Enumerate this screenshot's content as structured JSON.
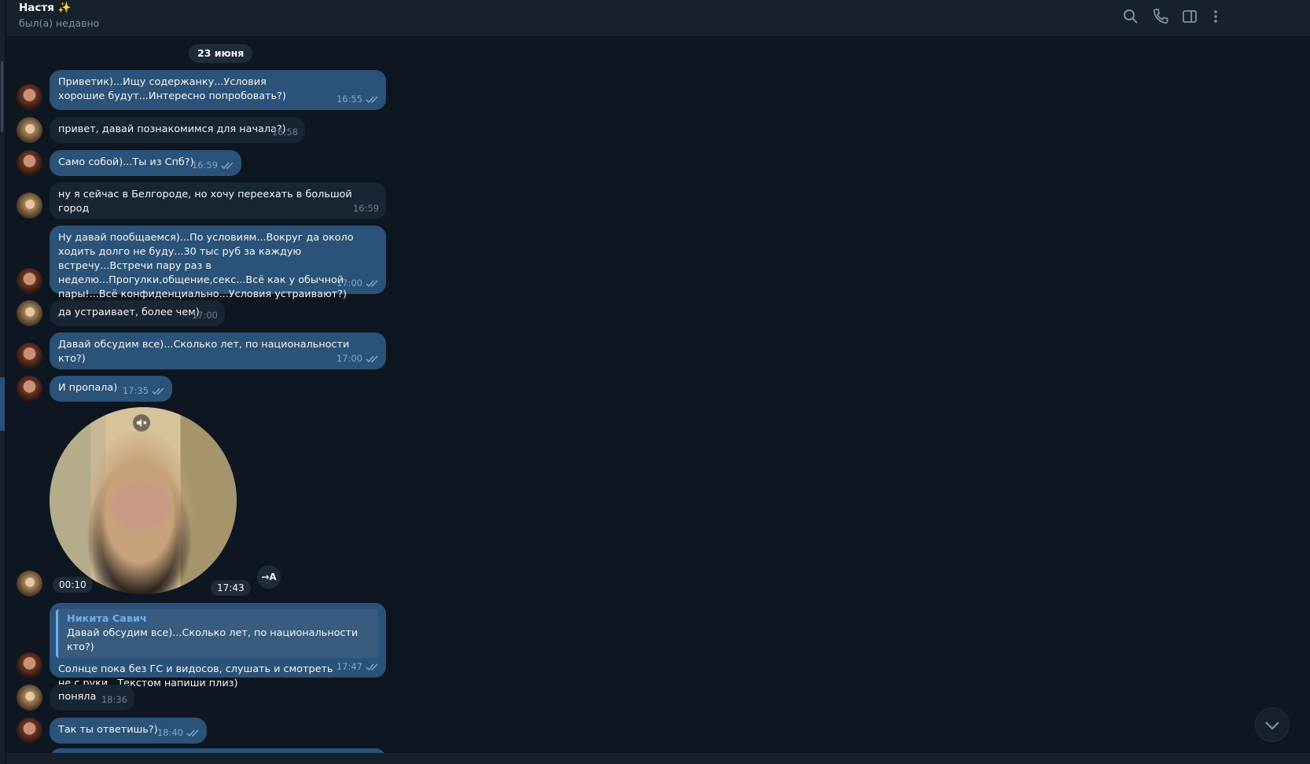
{
  "header": {
    "name": "Настя ✨",
    "status": "был(а) недавно",
    "icons": [
      "search-icon",
      "phone-icon",
      "sidebar-toggle-icon",
      "more-vertical-icon"
    ]
  },
  "date_separator": "23 июня",
  "messages": [
    {
      "id": "m1",
      "dir": "out",
      "text": "Приветик)...Ищу содержанку...Условия хорошие будут...Интересно попробовать?)",
      "time": "16:55",
      "read": true
    },
    {
      "id": "m2",
      "dir": "in",
      "text": "привет, давай познакомимся для начала?)",
      "time": "16:58"
    },
    {
      "id": "m3",
      "dir": "out",
      "text": "Само собой)...Ты из Спб?)",
      "time": "16:59",
      "read": true
    },
    {
      "id": "m4",
      "dir": "in",
      "text": "ну я сейчас в Белгороде, но хочу переехать в большой город",
      "time": "16:59"
    },
    {
      "id": "m5",
      "dir": "out",
      "text": "Ну давай пообщаемся)...По условиям...Вокруг да около ходить долго не буду...30 тыс руб за каждую встречу...Встречи пару раз в неделю...Прогулки,общение,секс...Всё как у обычной пары!...Всё конфиденциально...Условия устраивают?)",
      "time": "17:00",
      "read": true
    },
    {
      "id": "m6",
      "dir": "in",
      "text": "да устраивает, более чем)",
      "time": "17:00"
    },
    {
      "id": "m7",
      "dir": "out",
      "text": "Давай обсудим все)...Сколько лет, по национальности кто?)",
      "time": "17:00",
      "read": true
    },
    {
      "id": "m8",
      "dir": "out",
      "text": "И пропала)",
      "time": "17:35",
      "read": true
    },
    {
      "id": "m10",
      "dir": "out",
      "reply_name": "Никита Савич",
      "reply_text": "Давай обсудим все)...Сколько лет, по национальности кто?)",
      "text": "Солнце пока без ГС и видосов, слушать и смотреть не с руки...Текстом напиши плиз)",
      "time": "17:47",
      "read": true
    },
    {
      "id": "m11",
      "dir": "in",
      "text": "поняла",
      "time": "18:36"
    },
    {
      "id": "m12",
      "dir": "out",
      "text": "Так ты ответишь?)",
      "time": "18:40",
      "read": true
    }
  ],
  "video_message": {
    "duration": "00:10",
    "time": "17:43",
    "translate_label": "→A"
  },
  "colors": {
    "bg": "#0e1621",
    "outgoing": "#2b5278",
    "incoming": "#182533",
    "accent": "#6ab2f2"
  }
}
